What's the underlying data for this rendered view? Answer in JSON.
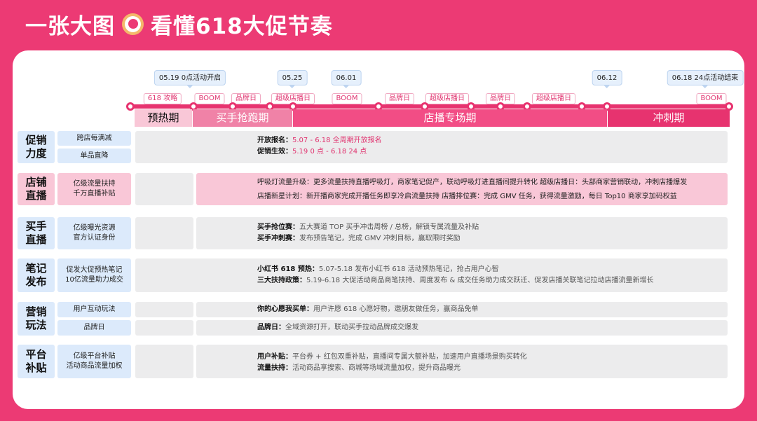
{
  "title": {
    "before": "一张大图",
    "after": "看懂618大促节奏"
  },
  "timeline": {
    "pins": [
      {
        "label": "05.19  0点活动开启"
      },
      {
        "label": "05.25"
      },
      {
        "label": "06.01"
      },
      {
        "label": "06.12"
      },
      {
        "label": "06.18  24点活动结束"
      }
    ],
    "tags": [
      "618 攻略",
      "BOOM",
      "品牌日",
      "超级店播日",
      "BOOM",
      "品牌日",
      "超级店播日",
      "品牌日",
      "超级店播日",
      "BOOM"
    ],
    "phases": [
      "预热期",
      "买手抢跑期",
      "店播专场期",
      "冲刺期"
    ]
  },
  "rows": [
    {
      "label": "促销\n力度",
      "subs": [
        "跨店每满减",
        "单品直降"
      ],
      "lines": [
        {
          "k": "开放报名：",
          "v": "5.07 - 6.18 全周期开放报名"
        },
        {
          "k": "促销生效：",
          "v": "5.19 0 点 - 6.18 24 点"
        }
      ]
    },
    {
      "label": "店铺\n直播",
      "subs": [
        "亿级流量扶持\n千万直播补贴"
      ],
      "lines": [
        {
          "k": "",
          "v": "呼吸灯流量升级：更多流量扶持直播呼吸灯，商家笔记促产，联动呼吸灯进直播间提升转化   超级店播日：头部商家营销联动，冲刺店播爆发"
        },
        {
          "k": "",
          "v": "店播新星计划：新开播商家完成开播任务即享冷启流量扶持    店播排位赛：完成 GMV 任务，获得流量激励，每日 Top10 商家享加码权益"
        }
      ]
    },
    {
      "label": "买手\n直播",
      "subs": [
        "亿级曝光资源\n官方认证身份"
      ],
      "lines": [
        {
          "k": "买手抢位赛：",
          "v": "五大赛道 TOP 买手冲击周榜 / 总榜，解锁专属流量及补贴"
        },
        {
          "k": "买手冲刺赛：",
          "v": "发布预告笔记，完成 GMV 冲刺目标，赢取限时奖励"
        }
      ]
    },
    {
      "label": "笔记\n发布",
      "subs": [
        "促发大促预热笔记\n10亿流量助力成交"
      ],
      "lines": [
        {
          "k": "小红书 618 预热：",
          "v": "5.07-5.18 发布小红书 618 活动预热笔记，抢占用户心智"
        },
        {
          "k": "三大扶持政策：",
          "v": "5.19-6.18 大促活动商品商笔扶持、周度发布 & 成交任务助力成交跃迁、促发店播关联笔记拉动店播流量新增长"
        }
      ]
    },
    {
      "label": "营销\n玩法",
      "subs": [
        "用户互动玩法",
        "品牌日"
      ],
      "lines": [
        {
          "k": "你的心愿我买单：",
          "v": "用户许愿 618 心愿好物，邀朋友做任务，赢商品免单"
        },
        {
          "k": "品牌日：",
          "v": "全域资源打开，联动买手拉动品牌成交爆发"
        }
      ]
    },
    {
      "label": "平台\n补贴",
      "subs": [
        "亿级平台补贴\n活动商品流量加权"
      ],
      "lines": [
        {
          "k": "用户补贴：",
          "v": "平台券 + 红包双重补贴，直播间专属大额补贴，加速用户直播场景购买转化"
        },
        {
          "k": "流量扶持：",
          "v": "活动商品享搜索、商城等场域流量加权，提升商品曝光"
        }
      ]
    }
  ]
}
